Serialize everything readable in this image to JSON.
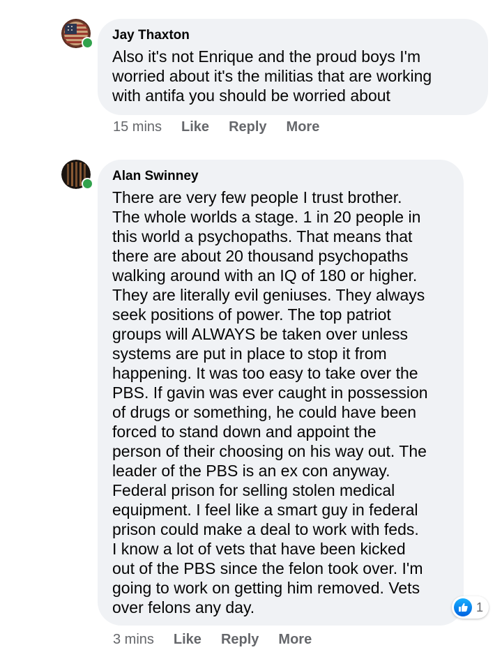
{
  "comments": [
    {
      "author": "Jay Thaxton",
      "text": "Also it's not Enrique and the proud boys I'm\nworried about it's the militias that are working\nwith antifa you should be worried about",
      "avatar_icon": "american-flag-avatar",
      "online": true,
      "time": "15 mins",
      "actions": [
        "Like",
        "Reply",
        "More"
      ]
    },
    {
      "author": "Alan Swinney",
      "text": "There are very few people I trust brother.\nThe whole worlds a stage. 1 in 20 people in\nthis world a psychopaths. That means that\nthere are about 20 thousand psychopaths\nwalking around with an IQ of 180 or higher.\nThey are literally evil geniuses. They always\nseek positions of power. The top patriot\ngroups will ALWAYS be taken over unless\nsystems are put in place to stop it from\nhappening. It was too easy to take over the\nPBS. If gavin was ever caught in possession\nof drugs or something, he could have been\nforced to stand down and appoint the\nperson of their choosing on his way out. The\nleader of the PBS is an ex con anyway.\nFederal prison for selling stolen medical\nequipment. I feel like a smart guy in federal\nprison could make a deal to work with feds.\nI know a lot of vets that have been kicked\nout of the PBS since the felon took over. I'm\ngoing to work on getting him removed. Vets\nover felons any day.",
      "avatar_icon": "dark-profile-avatar",
      "online": true,
      "time": "3 mins",
      "actions": [
        "Like",
        "Reply",
        "More"
      ],
      "reaction": {
        "icon": "like-icon",
        "count": "1"
      }
    }
  ],
  "colors": {
    "bubble": "#f0f2f5",
    "online": "#31a24c",
    "meta": "#65676b",
    "like_blue": "#1877f2"
  }
}
